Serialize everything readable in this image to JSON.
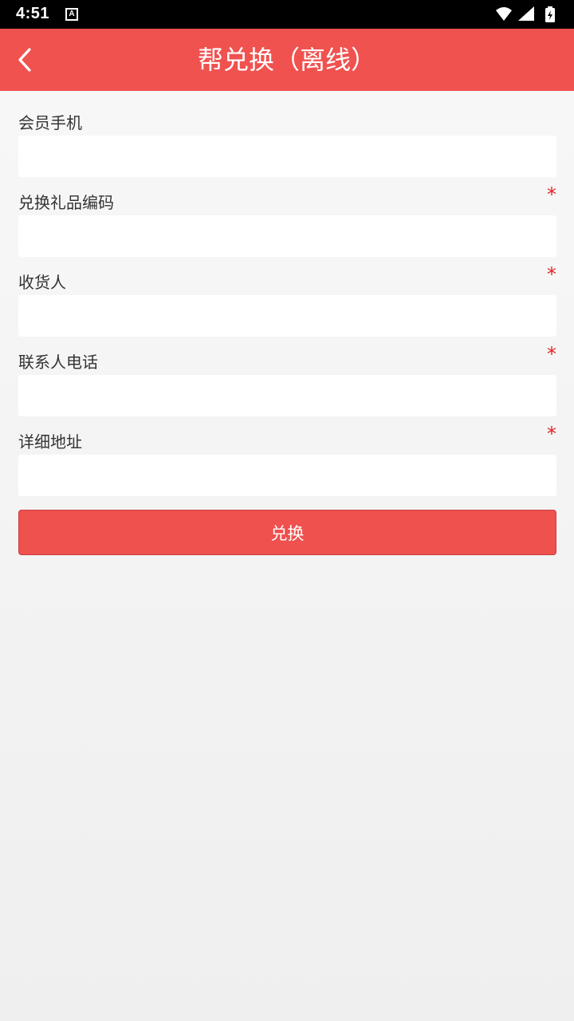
{
  "status_bar": {
    "time": "4:51",
    "notification_icon": "A",
    "icons": [
      "wifi-icon",
      "signal-icon",
      "battery-charging-icon"
    ]
  },
  "app_bar": {
    "back_icon": "chevron-left-icon",
    "title": "帮兑换（离线）"
  },
  "form": {
    "fields": [
      {
        "label": "会员手机",
        "required": false,
        "value": ""
      },
      {
        "label": "兑换礼品编码",
        "required": true,
        "value": ""
      },
      {
        "label": "收货人",
        "required": true,
        "value": ""
      },
      {
        "label": "联系人电话",
        "required": true,
        "value": ""
      },
      {
        "label": "详细地址",
        "required": true,
        "value": ""
      }
    ],
    "required_mark": "*",
    "submit_label": "兑换"
  },
  "colors": {
    "primary": "#f0524f",
    "required": "#e02424",
    "label": "#333333",
    "background": "#f5f5f5"
  }
}
